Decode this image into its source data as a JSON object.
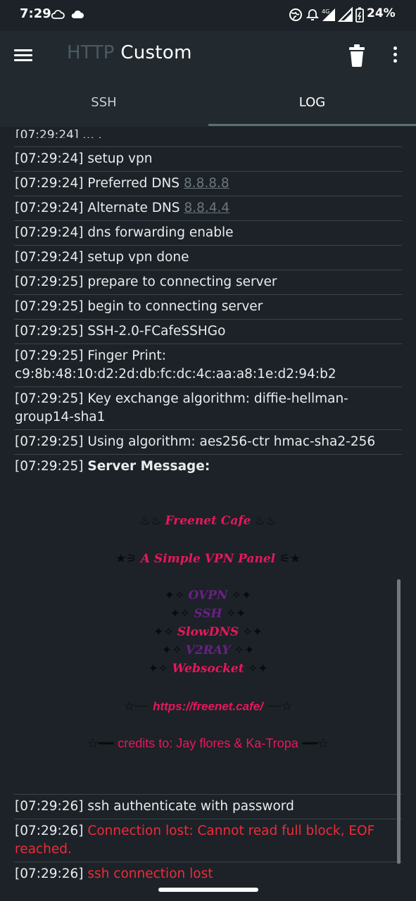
{
  "status_bar": {
    "time": "7:29",
    "battery": "24%",
    "icons": [
      "cloud-outline-icon",
      "cloud-icon",
      "vpn-globe-icon",
      "alarm-icon",
      "signal-4g-icon",
      "signal-icon",
      "battery-icon"
    ]
  },
  "appbar": {
    "title_part1": "HTTP",
    "title_part2": "Custom",
    "icons": [
      "menu-icon",
      "trash-icon",
      "more-vert-icon"
    ]
  },
  "tabs": {
    "ssh": "SSH",
    "log": "LOG",
    "active": "LOG"
  },
  "log": {
    "cut_text": "[07:29:24]  …  ,",
    "entries": [
      {
        "ts": "[07:29:24]",
        "msg": "setup vpn"
      },
      {
        "ts": "[07:29:24]",
        "msg": "Preferred DNS",
        "link": "8.8.8.8"
      },
      {
        "ts": "[07:29:24]",
        "msg": "Alternate DNS",
        "link": "8.8.4.4"
      },
      {
        "ts": "[07:29:24]",
        "msg": "dns forwarding enable"
      },
      {
        "ts": "[07:29:24]",
        "msg": "setup vpn done"
      },
      {
        "ts": "[07:29:25]",
        "msg": "prepare to connecting server"
      },
      {
        "ts": "[07:29:25]",
        "msg": "begin to connecting server"
      },
      {
        "ts": "[07:29:25]",
        "msg": "SSH-2.0-FCafeSSHGo"
      },
      {
        "ts": "[07:29:25]",
        "msg": "Finger Print: c9:8b:48:10:d2:2d:db:fc:dc:4c:aa:a8:1e:d2:94:b2"
      },
      {
        "ts": "[07:29:25]",
        "msg": "Key exchange algorithm: diffie-hellman-group14-sha1"
      },
      {
        "ts": "[07:29:25]",
        "msg": "Using algorithm: aes256-ctr hmac-sha2-256"
      },
      {
        "ts": "[07:29:25]",
        "msg": "Server Message:"
      }
    ],
    "banner": {
      "line1_sym_l": "♨♨",
      "line1": "Freenet Cafe",
      "line1_sym_r": "♨♨",
      "line2_sym_l": "★⚞",
      "line2": "A Simple VPN Panel",
      "line2_sym_r": "⚟★",
      "svc_sym_l": "✦✧",
      "svc_sym_r": "✧✦",
      "svc1": "OVPN",
      "svc2": "SSH",
      "svc3": "SlowDNS",
      "svc4": "V2RAY",
      "svc5": "Websocket",
      "url_sym_l": "☆┈┈",
      "url": "https://freenet.cafe/",
      "url_sym_r": "┈┈☆",
      "credits_sym_l": "☆━━",
      "credits": "credits to: Jay flores & Ka-Tropa",
      "credits_sym_r": "━━☆"
    },
    "after": [
      {
        "ts": "[07:29:26]",
        "msg": "ssh authenticate with password",
        "error": false
      },
      {
        "ts": "[07:29:26]",
        "msg": "Connection lost: Cannot read full block, EOF reached.",
        "error": true
      },
      {
        "ts": "[07:29:26]",
        "msg": "ssh connection lost",
        "error": true
      }
    ]
  },
  "colors": {
    "background": "#1c2227",
    "appbar": "#222a30",
    "error": "#ef2b3a",
    "banner_pink": "#e8175d",
    "banner_purple": "#6b1f86"
  }
}
